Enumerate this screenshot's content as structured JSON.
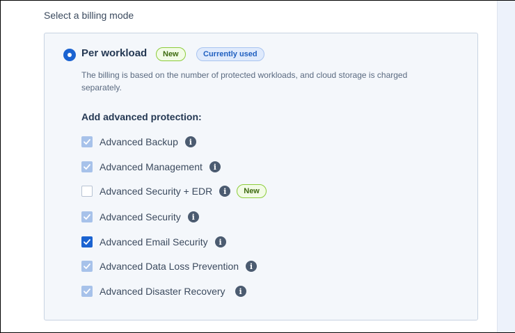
{
  "section": {
    "title": "Select a billing mode"
  },
  "mode": {
    "label": "Per workload",
    "selected": true,
    "badges": {
      "new": "New",
      "current": "Currently used"
    },
    "description": "The billing is based on the number of protected workloads, and cloud storage is charged separately."
  },
  "advanced": {
    "heading": "Add advanced protection:",
    "items": [
      {
        "label": "Advanced Backup",
        "state": "checked-disabled"
      },
      {
        "label": "Advanced Management",
        "state": "checked-disabled"
      },
      {
        "label": "Advanced Security + EDR",
        "state": "unchecked",
        "badge": "New"
      },
      {
        "label": "Advanced Security",
        "state": "checked-disabled"
      },
      {
        "label": "Advanced Email Security",
        "state": "checked"
      },
      {
        "label": "Advanced Data Loss Prevention",
        "state": "checked-disabled"
      },
      {
        "label": "Advanced Disaster Recovery",
        "state": "checked-disabled"
      }
    ],
    "info_icon_glyph": "i"
  },
  "colors": {
    "accent": "#1b63d1",
    "disabled_check": "#a7c2ea",
    "card_bg": "#f4f7fb",
    "badge_new_border": "#8ccc3a",
    "badge_used_bg": "#dfeafc"
  }
}
